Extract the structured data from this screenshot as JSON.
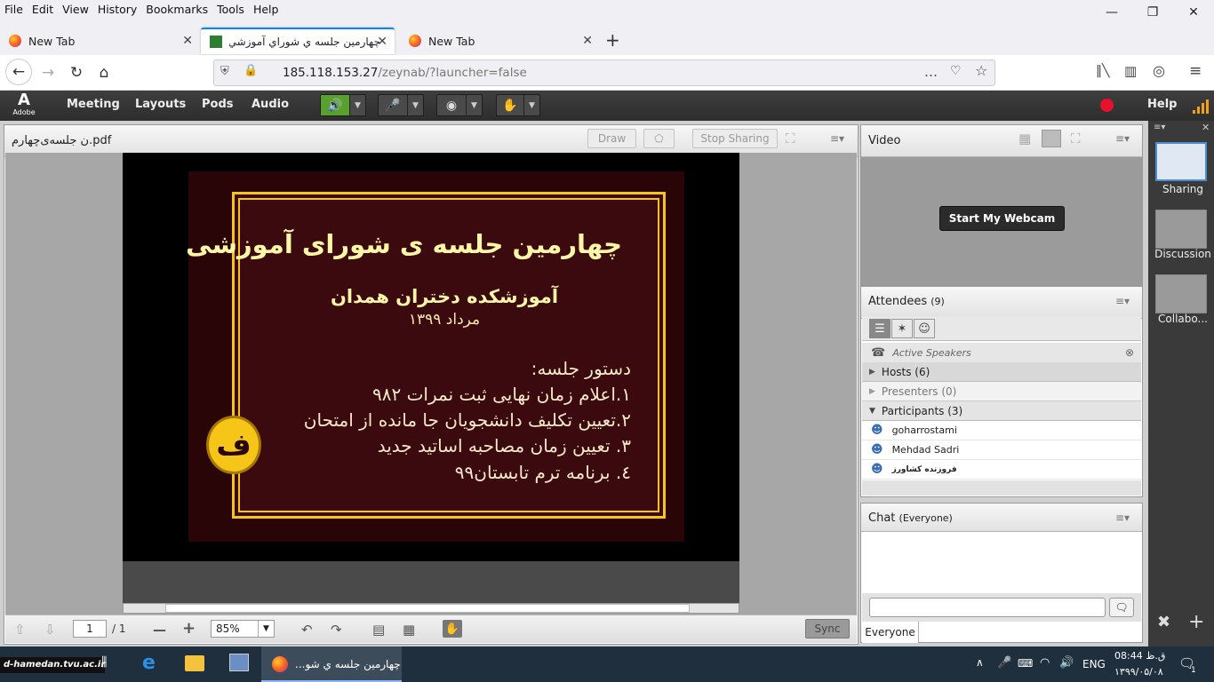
{
  "browser": {
    "menu": [
      "File",
      "Edit",
      "View",
      "History",
      "Bookmarks",
      "Tools",
      "Help"
    ],
    "tabs": [
      {
        "title": "New Tab"
      },
      {
        "title": "چهارمین جلسه ي شوراي آموزشي"
      },
      {
        "title": "New Tab"
      }
    ],
    "url_host": "185.118.153.27",
    "url_path": "/zeynab/?launcher=false"
  },
  "connect": {
    "logo_text": "Adobe",
    "menu": [
      "Meeting",
      "Layouts",
      "Pods",
      "Audio"
    ],
    "help_label": "Help",
    "recording_color": "#e8112d"
  },
  "share_pod": {
    "title": "ن جلسه‌ی‌چهارم.pdf",
    "draw_label": "Draw",
    "stop_sharing_label": "Stop Sharing",
    "page_current": "1",
    "page_total": "/ 1",
    "zoom": "85%",
    "sync_label": "Sync",
    "slide": {
      "title": "چهارمین جلسه ی شورای آموزشی",
      "subtitle": "آموزشکده دختران همدان",
      "date": "مرداد ۱۳۹۹",
      "agenda_heading": "دستور جلسه:",
      "agenda": [
        "۱.اعلام زمان نهایی ثبت نمرات ۹۸۲",
        "۲.تعیین تکلیف دانشجویان جا مانده از امتحان",
        "۳. تعیین زمان مصاحبه اساتید جدید",
        "٤. برنامه ترم تابستان۹۹"
      ]
    }
  },
  "video_pod": {
    "title": "Video",
    "start_webcam_label": "Start My Webcam"
  },
  "attendees_pod": {
    "title": "Attendees",
    "count": "(9)",
    "active_speakers": "Active Speakers",
    "groups": [
      {
        "label": "Hosts (6)"
      },
      {
        "label": "Presenters (0)"
      },
      {
        "label": "Participants (3)"
      }
    ],
    "participants": [
      "goharrostami",
      "Mehdad Sadri",
      "فروزنده کشاورز"
    ]
  },
  "chat_pod": {
    "title": "Chat",
    "scope": "(Everyone)",
    "input_placeholder": "",
    "tab_label": "Everyone"
  },
  "layouts": [
    {
      "label": "Sharing"
    },
    {
      "label": "Discussion"
    },
    {
      "label": "Collabo..."
    }
  ],
  "taskbar": {
    "brand": "d-hamedan.tvu.ac.ir",
    "active_window": "چهارمین جلسه ي شو...",
    "lang": "ENG",
    "time": "ق.ظ 08:44",
    "date": "۱۳۹۹/۰۵/۰۸",
    "notif_count": "1"
  }
}
